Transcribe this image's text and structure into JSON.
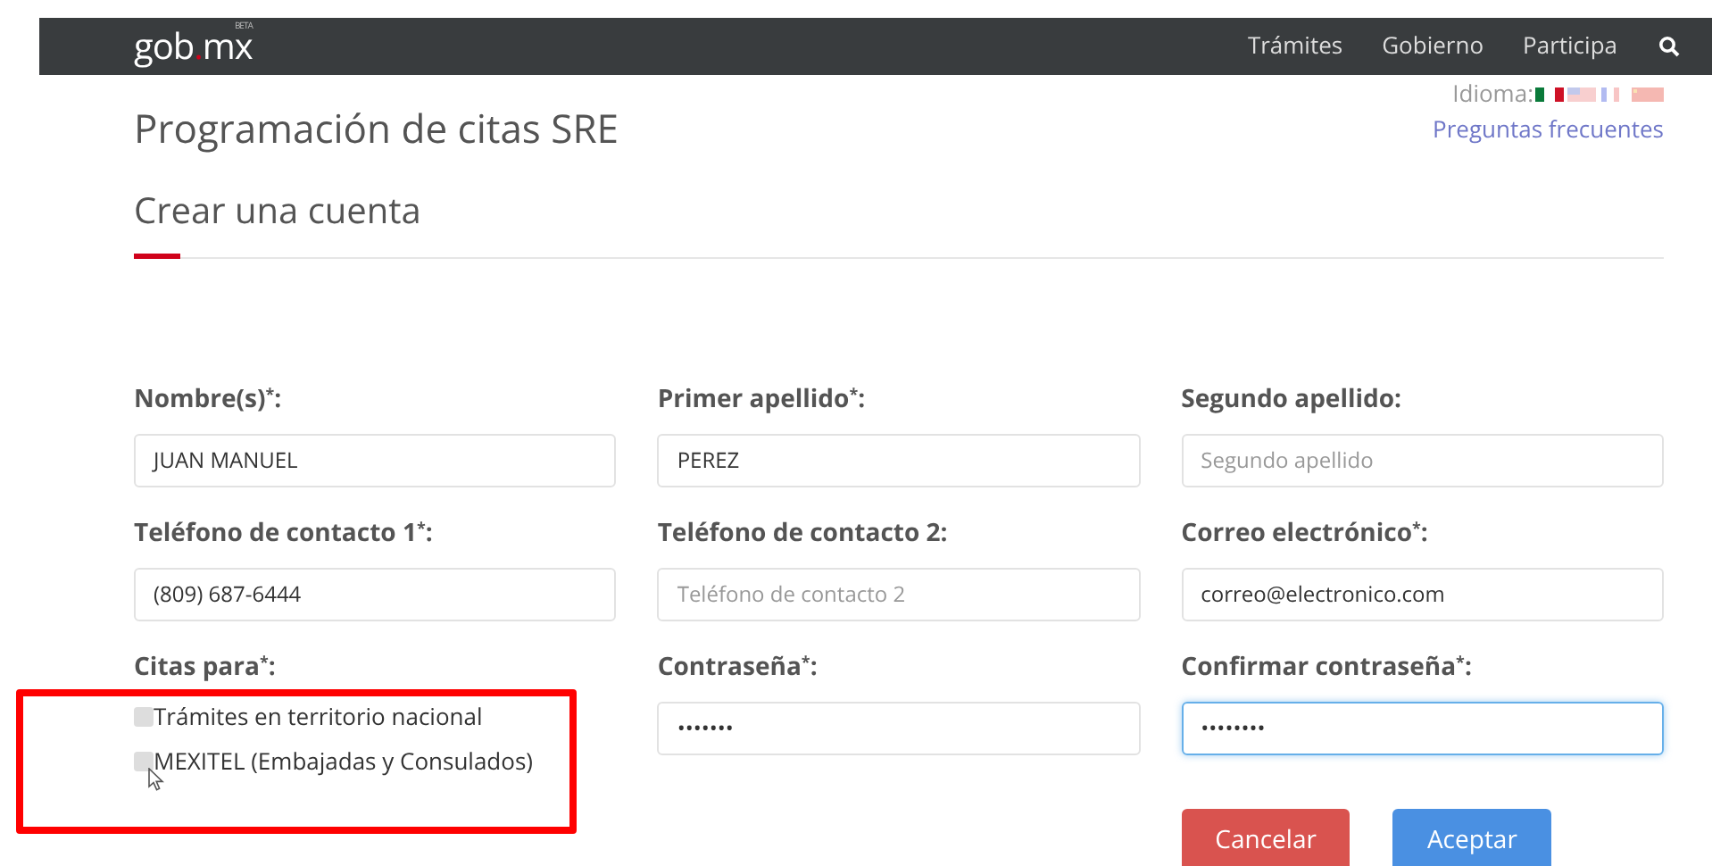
{
  "navbar": {
    "logo": "gob",
    "logo_dot": ".",
    "logo_suffix": "mx",
    "beta": "BETA",
    "links": [
      "Trámites",
      "Gobierno",
      "Participa"
    ]
  },
  "language": {
    "label": "Idioma:"
  },
  "faq_link": "Preguntas frecuentes",
  "title": "Programación de citas SRE",
  "subtitle": "Crear una cuenta",
  "fields": [
    {
      "label": "Nombre(s)$^{*}$:",
      "value": "JUAN MANUEL",
      "focused": false
    },
    {
      "label": "Primer apellido$^{*}$:",
      "value": "PEREZ",
      "focused": false
    },
    {
      "label": "Segundo apellido:",
      "placeholder": "Segundo apellido",
      "focused": false
    },
    {
      "label": "Teléfono de contacto 1$^{*}$:",
      "value": "(809) 687-6444",
      "focused": false
    },
    {
      "label": "Teléfono de contacto 2:",
      "placeholder": "Teléfono de contacto 2",
      "focused": false
    },
    {
      "label": "Correo electrónico$^{*}$:",
      "value": "correo@electronico.com",
      "focused": false
    }
  ],
  "citas": {
    "label": "Citas para$^{*}$:",
    "highlighted": true,
    "options": [
      {
        "label": "Trámites en territorio nacional",
        "checked": false
      },
      {
        "label": "MEXITEL (Embajadas y Consulados)",
        "checked": false
      }
    ]
  },
  "password_fields": [
    {
      "label": "Contraseña$^{*}$:",
      "value": "•••••••",
      "focused": false
    },
    {
      "label": "Confirmar contraseña$^{*}$:",
      "value": "••••••••",
      "focused": true
    }
  ],
  "buttons": [
    {
      "label": "Cancelar",
      "kind": "danger"
    },
    {
      "label": "Aceptar",
      "kind": "primary"
    }
  ]
}
